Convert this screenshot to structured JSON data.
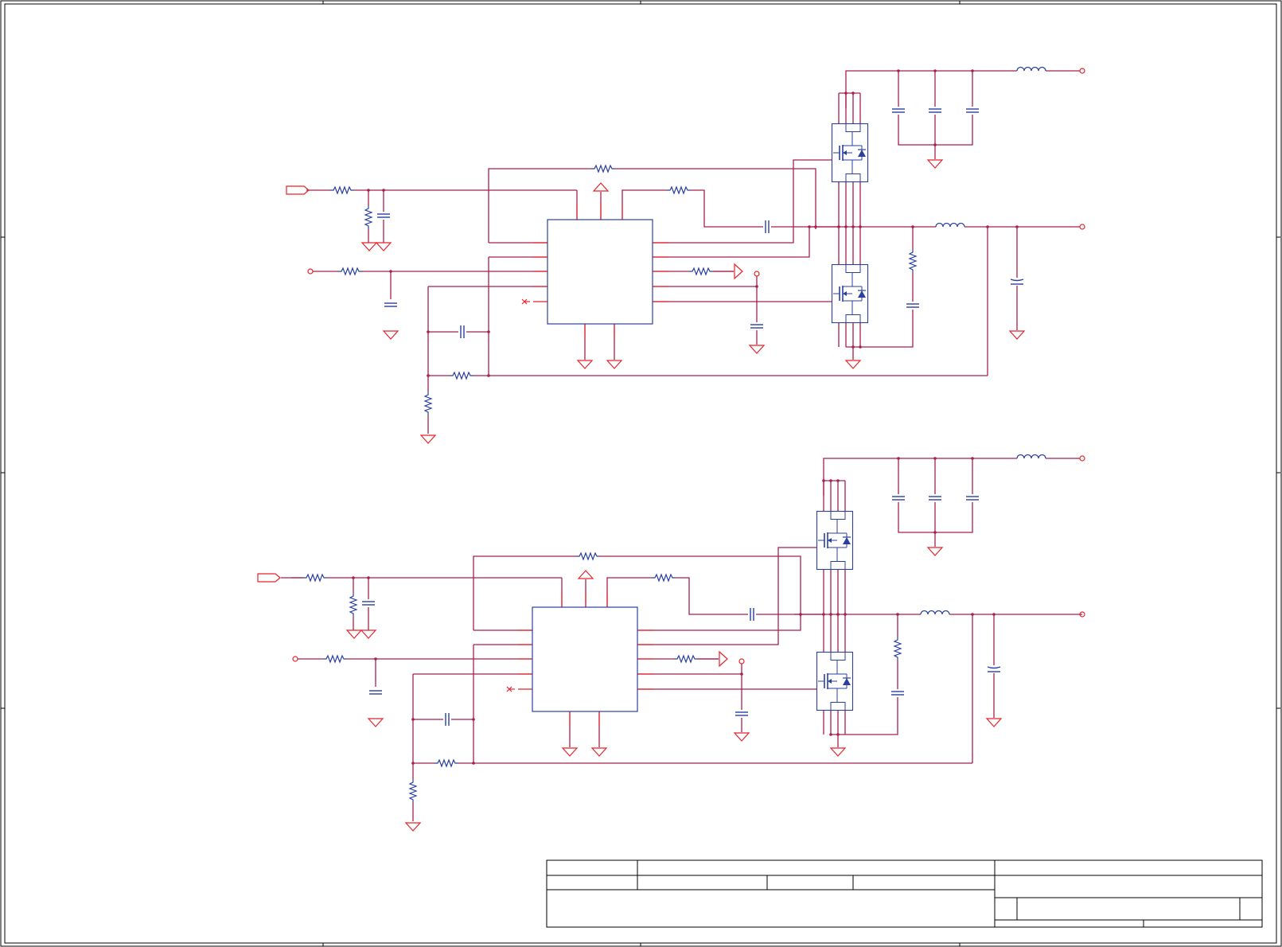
{
  "diagram": {
    "type": "electrical-schematic",
    "sheet": {
      "border_ticks_top": 3,
      "border_ticks_side": 3
    },
    "channels": [
      {
        "name": "",
        "controller_ic": "",
        "high_side_mosfet": "",
        "low_side_mosfet": "",
        "output_inductor": "",
        "input_filter_inductor": ""
      },
      {
        "name": "",
        "controller_ic": "",
        "high_side_mosfet": "",
        "low_side_mosfet": "",
        "output_inductor": "",
        "input_filter_inductor": ""
      }
    ],
    "title_block": {
      "cells": [
        "",
        "",
        "",
        "",
        "",
        "",
        "",
        "",
        ""
      ]
    },
    "colors": {
      "wire": "#a8204a",
      "pin": "#e8232b",
      "component": "#2b3fa0",
      "frame": "#000000",
      "background": "#ffffff"
    }
  }
}
